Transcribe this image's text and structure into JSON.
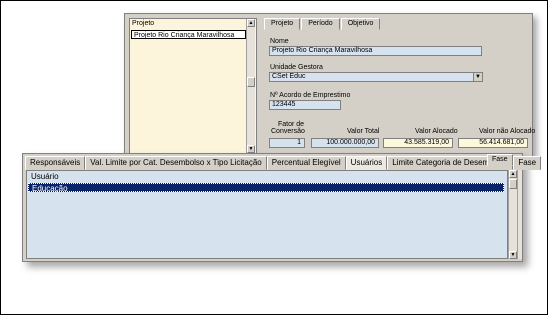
{
  "project_list": {
    "header": "Projeto",
    "items": [
      "Projeto Rio Criança Maravilhosa"
    ]
  },
  "upper_tabs": [
    {
      "label": "Projeto",
      "active": true
    },
    {
      "label": "Período",
      "active": false
    },
    {
      "label": "Objetivo",
      "active": false
    }
  ],
  "form": {
    "nome_label": "Nome",
    "nome_value": "Projeto Rio Criança Maravilhosa",
    "unidade_label": "Unidade Gestora",
    "unidade_value": "CSet Educ",
    "acordo_label": "Nº Acordo de Emprestimo",
    "acordo_value": "123445",
    "fator_label_1": "Fator de",
    "fator_label_2": "Conversão",
    "fator_value": "1",
    "valor_total_label": "Valor Total",
    "valor_total_value": "100.000.000,00",
    "valor_alocado_label": "Valor Alocado",
    "valor_alocado_value": "43.585.319,00",
    "valor_nao_alocado_label": "Valor não Alocado",
    "valor_nao_alocado_value": "56.414.681,00"
  },
  "lower_tabs": [
    {
      "label": "Responsáveis",
      "active": false
    },
    {
      "label": "Val. Limite por Cat. Desembolso x Tipo Licitação",
      "active": false
    },
    {
      "label": "Percentual Elegível",
      "active": false
    },
    {
      "label": "Usuários",
      "active": true
    },
    {
      "label": "Limite Categoria de Desembolso",
      "active": false
    },
    {
      "label": "Fase",
      "active": false
    }
  ],
  "fase_subtab": "Fase",
  "grid": {
    "header": "Usuário",
    "rows": [
      "Educação"
    ]
  },
  "colors": {
    "window_bg": "#d4d0c8",
    "field_bg": "#d6e2ee",
    "list_bg": "#fcf5dc",
    "selection": "#0a246a"
  }
}
